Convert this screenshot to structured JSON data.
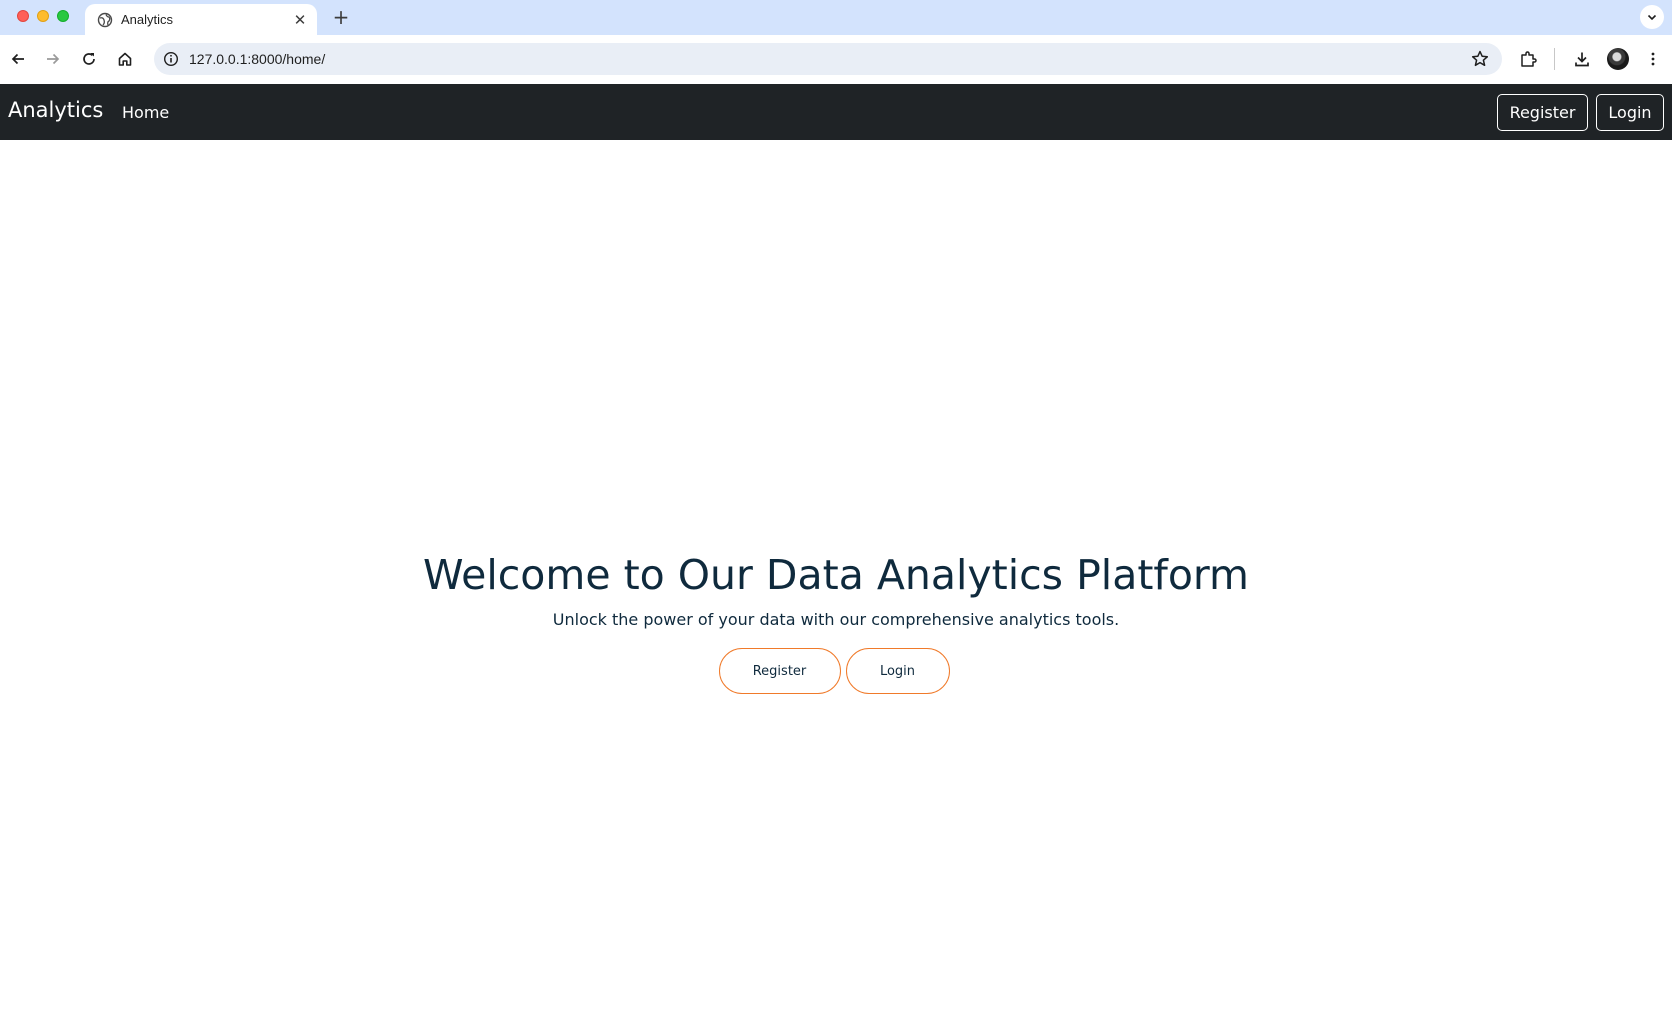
{
  "browser": {
    "tab": {
      "title": "Analytics",
      "favicon": "globe-icon",
      "close_icon": "close-icon"
    },
    "new_tab_icon": "plus-icon",
    "tab_search_icon": "chevron-down-icon",
    "nav_icons": [
      "back-arrow-icon",
      "forward-arrow-icon",
      "reload-icon",
      "home-icon"
    ],
    "address_bar": {
      "url": "127.0.0.1:8000/home/",
      "info_icon": "info-icon",
      "bookmark_icon": "star-icon"
    },
    "toolbar_icons": [
      "extensions-icon",
      "download-icon",
      "profile-avatar",
      "more-vert-icon"
    ],
    "colors": {
      "tabstrip": "#d3e3fd",
      "omnibox": "#e9eef6"
    }
  },
  "navbar": {
    "brand": "Analytics",
    "links": [
      "Home"
    ],
    "register_label": "Register",
    "login_label": "Login",
    "background": "#1f2326"
  },
  "hero": {
    "title": "Welcome to Our Data Analytics Platform",
    "subtitle": "Unlock the power of your data with our comprehensive analytics tools.",
    "register_label": "Register",
    "login_label": "Login",
    "accent": "#f07a2a",
    "text_color": "#0f2a3d"
  }
}
